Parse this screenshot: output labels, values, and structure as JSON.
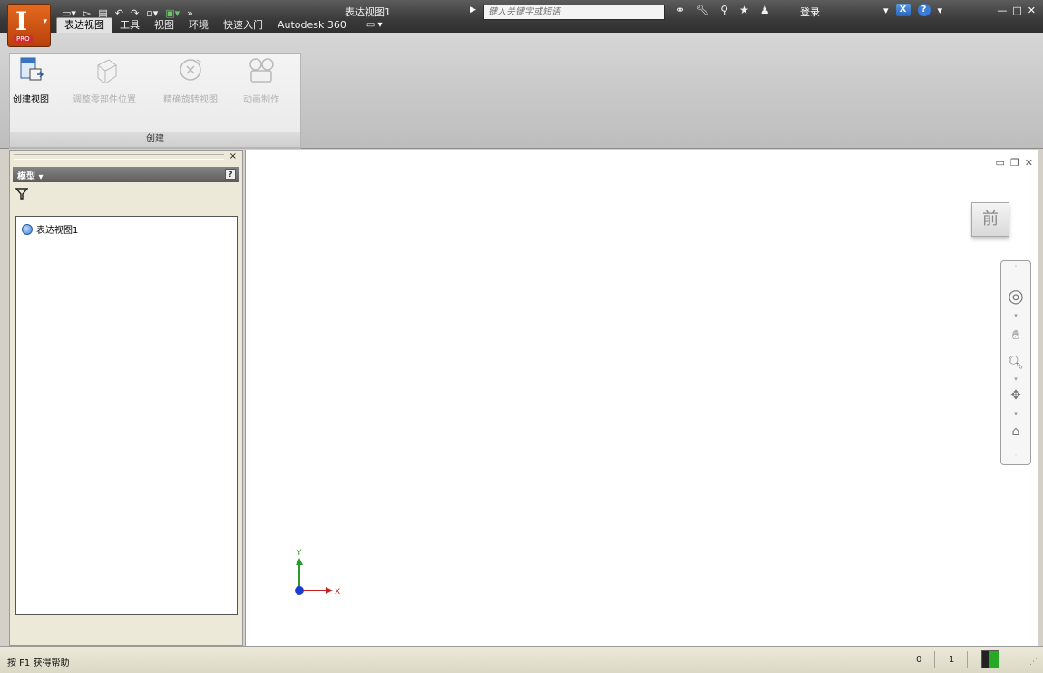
{
  "app": {
    "logo_glyph": "I",
    "logo_badge": "PRO",
    "window_title": "表达视图1",
    "quick_access_icons": [
      "new-file-icon",
      "open-icon",
      "save-icon",
      "undo-icon",
      "redo-icon",
      "select-icon",
      "appearance-icon",
      "more-icon"
    ]
  },
  "search": {
    "placeholder": "键入关键字或短语"
  },
  "account": {
    "login_label": "登录"
  },
  "tabs": [
    {
      "label": "表达视图",
      "active": true
    },
    {
      "label": "工具",
      "active": false
    },
    {
      "label": "视图",
      "active": false
    },
    {
      "label": "环境",
      "active": false
    },
    {
      "label": "快速入门",
      "active": false
    },
    {
      "label": "Autodesk 360",
      "active": false
    }
  ],
  "ribbon": {
    "panel_title": "创建",
    "buttons": [
      {
        "label": "创建视图",
        "enabled": true,
        "icon": "create-view-icon"
      },
      {
        "label": "调整零部件位置",
        "enabled": false,
        "icon": "tweak-components-icon"
      },
      {
        "label": "精确旋转视图",
        "enabled": false,
        "icon": "precise-rotate-icon"
      },
      {
        "label": "动画制作",
        "enabled": false,
        "icon": "animate-icon"
      }
    ]
  },
  "browser": {
    "header": "模型 ▾",
    "close": "×",
    "help": "?",
    "tree": [
      {
        "label": "表达视图1",
        "icon": "presentation-icon"
      }
    ]
  },
  "viewport": {
    "viewcube_face": "前",
    "axis_x": "X",
    "axis_y": "Y",
    "nav_tools": [
      "steering-wheel-icon",
      "pan-icon",
      "zoom-icon",
      "orbit-icon",
      "look-at-icon"
    ]
  },
  "status": {
    "help_text": "按 F1 获得帮助",
    "count1": "0",
    "count2": "1"
  },
  "colors": {
    "app_button": "#d35a15",
    "title_bar": "#3a3a3a",
    "axis_x": "#c82020",
    "axis_y": "#2a9a2a",
    "axis_z": "#1e3cd0"
  }
}
